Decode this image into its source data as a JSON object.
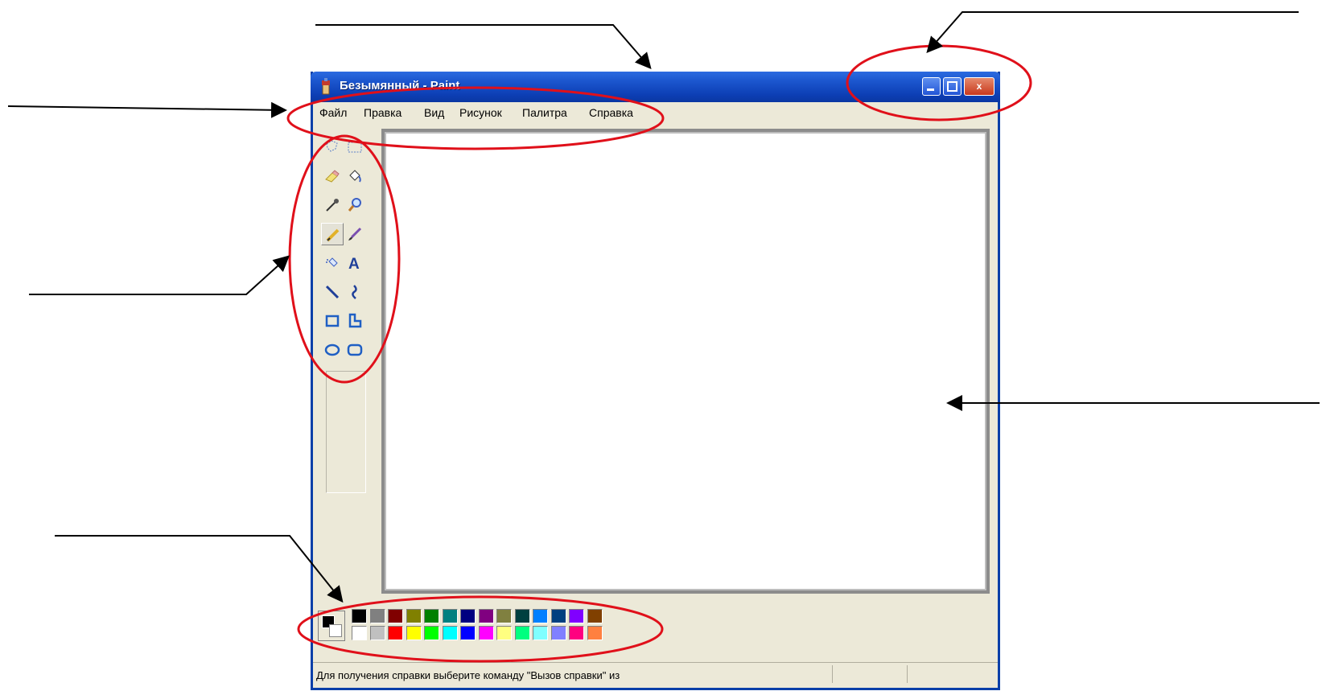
{
  "window": {
    "title": "Безымянный - Paint",
    "controls": {
      "minimize_icon": "minimize-icon",
      "maximize_icon": "maximize-icon",
      "close_label": "x"
    }
  },
  "menubar": {
    "items": [
      {
        "label": "Файл"
      },
      {
        "label": "Правка"
      },
      {
        "label": "Вид"
      },
      {
        "label": "Рисунок"
      },
      {
        "label": "Палитра"
      },
      {
        "label": "Справка"
      }
    ]
  },
  "toolbox": {
    "tools": [
      "free-form-select-icon",
      "rectangle-select-icon",
      "eraser-icon",
      "fill-bucket-icon",
      "color-picker-icon",
      "magnifier-icon",
      "pencil-icon",
      "brush-icon",
      "airbrush-icon",
      "text-icon",
      "line-icon",
      "curve-icon",
      "rectangle-icon",
      "polygon-icon",
      "ellipse-icon",
      "rounded-rectangle-icon"
    ],
    "active_tool": "pencil-icon",
    "text_tool_glyph": "A"
  },
  "palette": {
    "foreground": "#000000",
    "background": "#ffffff",
    "top_row": [
      "#000000",
      "#808080",
      "#800000",
      "#808000",
      "#008000",
      "#008080",
      "#000080",
      "#800080",
      "#808040",
      "#004040",
      "#0080ff",
      "#004080",
      "#8000ff",
      "#804000"
    ],
    "bottom_row": [
      "#ffffff",
      "#c0c0c0",
      "#ff0000",
      "#ffff00",
      "#00ff00",
      "#00ffff",
      "#0000ff",
      "#ff00ff",
      "#ffff80",
      "#00ff80",
      "#80ffff",
      "#8080ff",
      "#ff0080",
      "#ff8040"
    ]
  },
  "statusbar": {
    "text": "Для получения справки выберите команду \"Вызов справки\" из"
  },
  "annotation_colors": {
    "ellipse": "#e0101a",
    "arrow": "#000000"
  }
}
